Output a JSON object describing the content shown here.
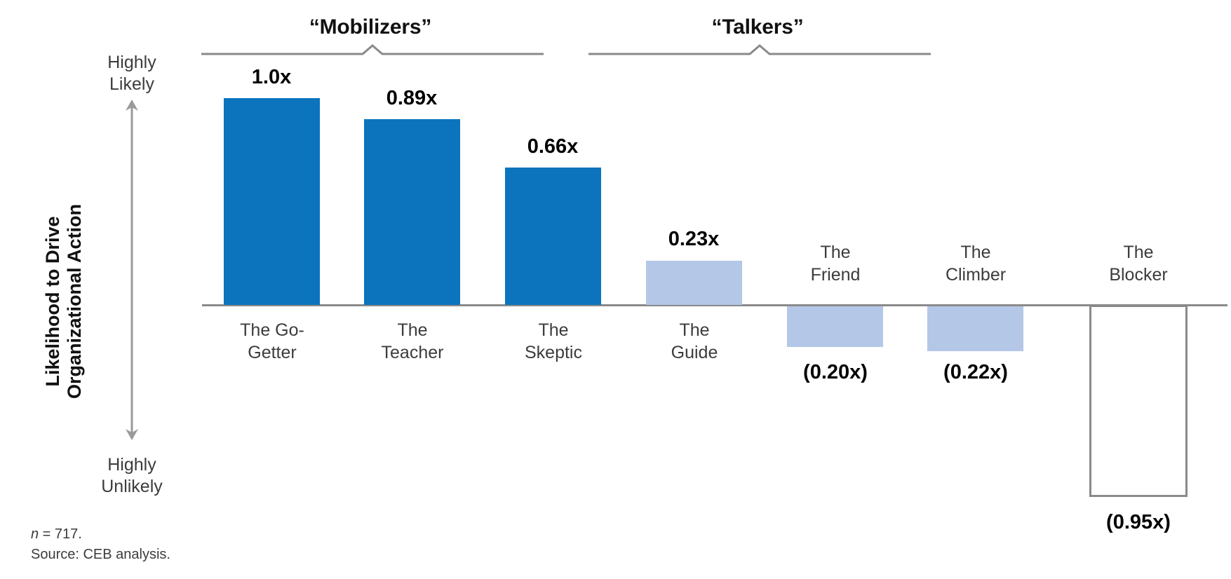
{
  "chart_data": {
    "type": "bar",
    "title": "",
    "subtitle": "",
    "xlabel": "",
    "ylabel": "Likelihood to Drive Organizational Action",
    "ylim": [
      -1.0,
      1.08
    ],
    "grid": false,
    "legend_position": "none",
    "axis_top_label": "Highly\nLikely",
    "axis_bottom_label": "Highly\nUnlikely",
    "categories": [
      "The Go-\nGetter",
      "The\nTeacher",
      "The\nSkeptic",
      "The\nGuide",
      "The\nFriend",
      "The\nClimber",
      "The\nBlocker"
    ],
    "values": [
      1.0,
      0.89,
      0.66,
      0.23,
      -0.2,
      -0.22,
      -0.95
    ],
    "value_labels": [
      "1.0x",
      "0.89x",
      "0.66x",
      "0.23x",
      "(0.20x)",
      "(0.22x)",
      "(0.95x)"
    ],
    "bar_styles": [
      "solid-dark",
      "solid-dark",
      "solid-dark",
      "solid-light",
      "solid-light",
      "solid-light",
      "outline"
    ],
    "groups": [
      {
        "label": "“Mobilizers”",
        "members": [
          "The Go-Getter",
          "The Teacher",
          "The Skeptic"
        ]
      },
      {
        "label": "“Talkers”",
        "members": [
          "The Guide",
          "The Friend",
          "The Climber",
          "The Blocker"
        ]
      }
    ],
    "colors": {
      "bar_dark": "#0b74bc",
      "bar_light": "#b4c7e7",
      "bar_outline": "#8a8a8a",
      "axis": "#8a8a8a",
      "text": "#3c3c3c",
      "value_text": "#000000"
    },
    "annotations": []
  },
  "footnote": {
    "n_prefix": "n",
    "n_value": " = 717.",
    "source": "Source: CEB analysis."
  }
}
